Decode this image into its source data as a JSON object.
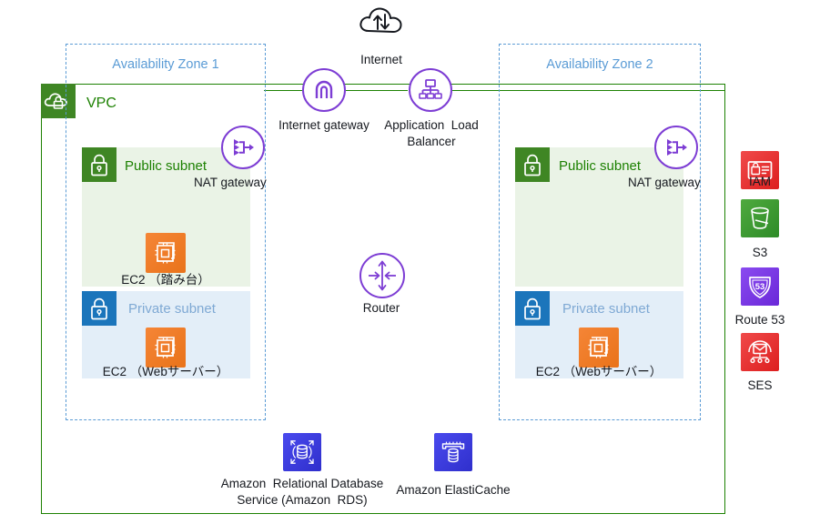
{
  "diagram": {
    "title": "AWS multi-AZ VPC architecture",
    "colors": {
      "vpc_green": "#1d8102",
      "az_blue": "#5a9bd5",
      "purple": "#7d3dd4",
      "public_subnet_bg": "#eaf3e6",
      "private_subnet_bg": "#e3eef8",
      "ec2_orange": "#ed7100",
      "iam_red": "#e32c2c",
      "s3_green": "#3f9b35",
      "route53_purple": "#7a3ee8",
      "ses_red": "#e32c2c",
      "rds_blue": "#3b3bdb",
      "elasticache_blue": "#3b3bdb"
    },
    "vpc": {
      "label": "VPC",
      "icon": "vpc-cloud-lock-icon"
    },
    "internet": {
      "label": "Internet",
      "icon": "internet-cloud-icon"
    },
    "internet_gateway": {
      "label": "Internet gateway",
      "icon": "internet-gateway-icon"
    },
    "load_balancer": {
      "label_line1": "Application  Load",
      "label_line2": "Balancer",
      "icon": "application-load-balancer-icon"
    },
    "router": {
      "label": "Router",
      "icon": "router-icon"
    },
    "availability_zones": [
      {
        "label": "Availability Zone 1",
        "public_subnet": {
          "label": "Public subnet",
          "icon": "public-subnet-lock-icon"
        },
        "private_subnet": {
          "label": "Private subnet",
          "icon": "private-subnet-lock-icon"
        },
        "nat_gateway": {
          "label": "NAT gateway",
          "icon": "nat-gateway-icon"
        },
        "public_instance": {
          "label": "EC2 （踏み台）",
          "icon": "ec2-instance-icon"
        },
        "private_instance": {
          "label": "EC2 （Webサーバー）",
          "icon": "ec2-instance-icon"
        }
      },
      {
        "label": "Availability Zone 2",
        "public_subnet": {
          "label": "Public subnet",
          "icon": "public-subnet-lock-icon"
        },
        "private_subnet": {
          "label": "Private subnet",
          "icon": "private-subnet-lock-icon"
        },
        "nat_gateway": {
          "label": "NAT gateway",
          "icon": "nat-gateway-icon"
        },
        "private_instance": {
          "label": "EC2 （Webサーバー）",
          "icon": "ec2-instance-icon"
        }
      }
    ],
    "data_services": [
      {
        "label_line1": "Amazon  Relational Database",
        "label_line2": "Service (Amazon  RDS)",
        "icon": "amazon-rds-icon"
      },
      {
        "label_line1": "Amazon ElastiCache",
        "label_line2": "",
        "icon": "amazon-elasticache-icon"
      }
    ],
    "global_services": [
      {
        "label": "IAM",
        "icon": "iam-icon"
      },
      {
        "label": "S3",
        "icon": "s3-bucket-icon"
      },
      {
        "label": "Route 53",
        "icon": "route53-icon"
      },
      {
        "label": "SES",
        "icon": "ses-icon"
      }
    ]
  }
}
